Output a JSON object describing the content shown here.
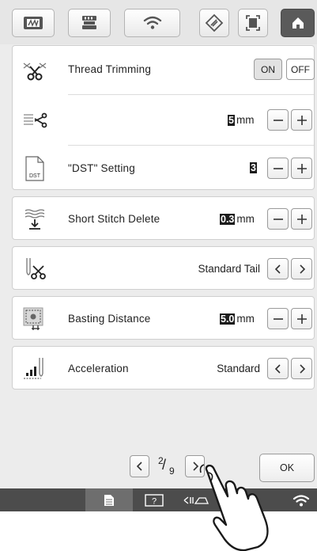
{
  "top_tabs": [
    {
      "icon": "embroidery-frame-icon",
      "active": false
    },
    {
      "icon": "sewing-machine-icon",
      "active": false
    },
    {
      "icon": "wifi-icon",
      "active": false
    },
    {
      "icon": "diamond-settings-icon",
      "active": false
    },
    {
      "icon": "screen-frame-icon",
      "active": false
    },
    {
      "icon": "home-icon",
      "active": true
    }
  ],
  "thread_trimming": {
    "label": "Thread Trimming",
    "on_label": "ON",
    "off_label": "OFF",
    "selected": "ON"
  },
  "jump_stitch_trim": {
    "value": "5",
    "unit": "mm"
  },
  "dst_setting": {
    "label": "\"DST\" Setting",
    "icon_text": "DST",
    "value": "3"
  },
  "short_stitch_delete": {
    "label": "Short Stitch Delete",
    "value": "0.3",
    "unit": "mm"
  },
  "tail": {
    "value": "Standard Tail"
  },
  "basting_distance": {
    "label": "Basting Distance",
    "value": "5.0",
    "unit": "mm"
  },
  "acceleration": {
    "label": "Acceleration",
    "value": "Standard"
  },
  "pager": {
    "current": "2",
    "total": "9"
  },
  "ok_label": "OK",
  "colors": {
    "background": "#ececec",
    "panel": "#ffffff",
    "active_tab": "#5a5a5a",
    "status_bar": "#4c4c4c",
    "value_highlight": "#1c1c1c"
  }
}
